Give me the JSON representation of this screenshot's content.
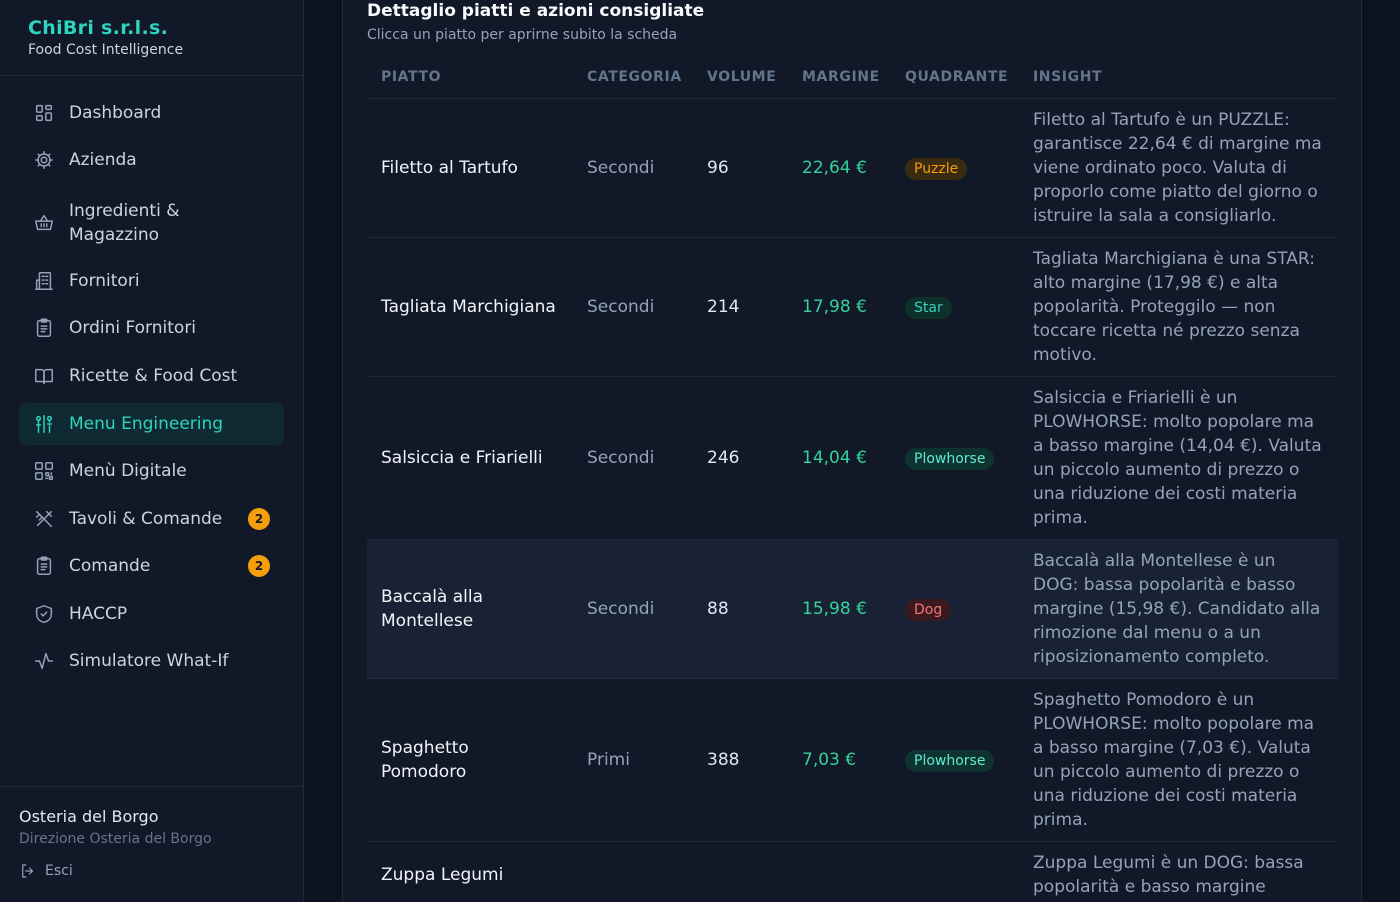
{
  "brand": {
    "name": "ChiBri s.r.l.s.",
    "subtitle": "Food Cost Intelligence"
  },
  "nav": [
    {
      "label": "Dashboard",
      "icon": "dashboard-icon",
      "active": false
    },
    {
      "label": "Azienda",
      "icon": "gear-icon",
      "active": false
    },
    {
      "label": "Ingredienti & Magazzino",
      "icon": "basket-icon",
      "active": false
    },
    {
      "label": "Fornitori",
      "icon": "building-icon",
      "active": false
    },
    {
      "label": "Ordini Fornitori",
      "icon": "clipboard-icon",
      "active": false
    },
    {
      "label": "Ricette & Food Cost",
      "icon": "book-icon",
      "active": false
    },
    {
      "label": "Menu Engineering",
      "icon": "engineering-icon",
      "active": true
    },
    {
      "label": "Menù Digitale",
      "icon": "qr-code-icon",
      "active": false
    },
    {
      "label": "Tavoli & Comande",
      "icon": "utensils-icon",
      "active": false,
      "badge": "2"
    },
    {
      "label": "Comande",
      "icon": "clipboard-icon",
      "active": false,
      "badge": "2"
    },
    {
      "label": "HACCP",
      "icon": "shield-icon",
      "active": false
    },
    {
      "label": "Simulatore What-If",
      "icon": "activity-icon",
      "active": false
    }
  ],
  "footer": {
    "name": "Osteria del Borgo",
    "role": "Direzione Osteria del Borgo",
    "logout": "Esci"
  },
  "section": {
    "title": "Dettaglio piatti e azioni consigliate",
    "subtitle": "Clicca un piatto per aprirne subito la scheda"
  },
  "table": {
    "headers": [
      "PIATTO",
      "CATEGORIA",
      "VOLUME",
      "MARGINE",
      "QUADRANTE",
      "INSIGHT"
    ],
    "rows": [
      {
        "dish": "Filetto al Tartufo",
        "category": "Secondi",
        "volume": "96",
        "margin": "22,64 €",
        "quadrant": "Puzzle",
        "quadrant_class": "puzzle",
        "insight": "Filetto al Tartufo è un PUZZLE: garantisce 22,64 € di margine ma viene ordinato poco. Valuta di proporlo come piatto del giorno o istruire la sala a consigliarlo."
      },
      {
        "dish": "Tagliata Marchigiana",
        "category": "Secondi",
        "volume": "214",
        "margin": "17,98 €",
        "quadrant": "Star",
        "quadrant_class": "star",
        "insight": "Tagliata Marchigiana è una STAR: alto margine (17,98 €) e alta popolarità. Proteggilo — non toccare ricetta né prezzo senza motivo."
      },
      {
        "dish": "Salsiccia e Friarielli",
        "category": "Secondi",
        "volume": "246",
        "margin": "14,04 €",
        "quadrant": "Plowhorse",
        "quadrant_class": "plowhorse",
        "insight": "Salsiccia e Friarielli è un PLOWHORSE: molto popolare ma a basso margine (14,04 €). Valuta un piccolo aumento di prezzo o una riduzione dei costi materia prima."
      },
      {
        "dish": "Baccalà alla Montellese",
        "category": "Secondi",
        "volume": "88",
        "margin": "15,98 €",
        "quadrant": "Dog",
        "quadrant_class": "dog",
        "insight": "Baccalà alla Montellese è un DOG: bassa popolarità e basso margine (15,98 €). Candidato alla rimozione dal menu o a un riposizionamento completo."
      },
      {
        "dish": "Spaghetto Pomodoro",
        "category": "Primi",
        "volume": "388",
        "margin": "7,03 €",
        "quadrant": "Plowhorse",
        "quadrant_class": "plowhorse",
        "insight": "Spaghetto Pomodoro è un PLOWHORSE: molto popolare ma a basso margine (7,03 €). Valuta un piccolo aumento di prezzo o una riduzione dei costi materia prima."
      },
      {
        "dish": "Zuppa Legumi",
        "category": "",
        "volume": "",
        "margin": "",
        "quadrant": "",
        "quadrant_class": "dog",
        "insight": "Zuppa Legumi è un DOG: bassa popolarità e basso margine"
      }
    ]
  }
}
